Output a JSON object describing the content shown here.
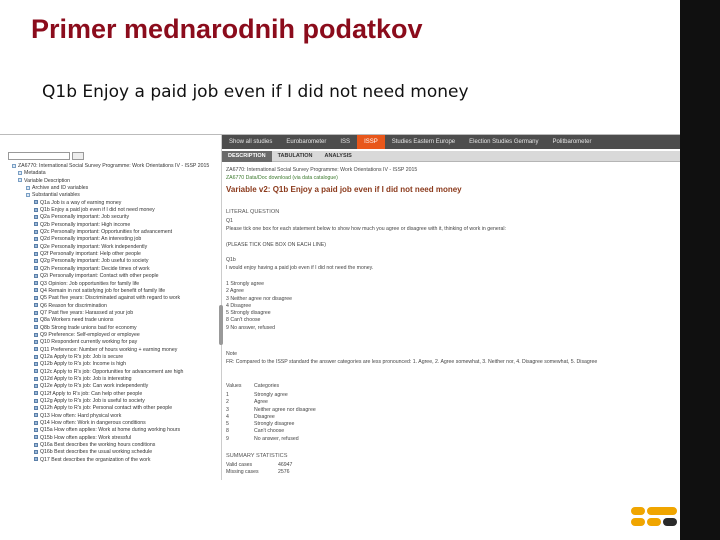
{
  "slide": {
    "title": "Primer mednarodnih podatkov",
    "subtitle": "Q1b Enjoy a paid job even if I did not need money"
  },
  "colors": {
    "title": "#8b0c1c",
    "nav_bg": "#4d4d4d",
    "nav_active": "#e8571b",
    "sidebar": "#101010"
  },
  "screenshot": {
    "nav": [
      "Show all studies",
      "Eurobarometer",
      "ISS",
      "ISSP",
      "Studies Eastern Europe",
      "Election Studies Germany",
      "Politbarometer"
    ],
    "nav_active_index": 3,
    "subtabs": [
      "DESCRIPTION",
      "TABULATION",
      "ANALYSIS"
    ],
    "subtab_active_index": 0,
    "tree": [
      "ZA6770: International Social Survey Programme: Work Orientations IV - ISSP 2015",
      "Metadata",
      "Variable Description",
      "Archive and ID variables",
      "Substantial variables",
      "Q1a Job is a way of earning money",
      "Q1b Enjoy a paid job even if I did not need money",
      "Q2a Personally important: Job security",
      "Q2b Personally important: High income",
      "Q2c Personally important: Opportunities for advancement",
      "Q2d Personally important: An interesting job",
      "Q2e Personally important: Work independently",
      "Q2f Personally important: Help other people",
      "Q2g Personally important: Job useful to society",
      "Q2h Personally important: Decide times of work",
      "Q2i Personally important: Contact with other people",
      "Q3 Opinion: Job opportunities for family life",
      "Q4 Remain in not satisfying job for benefit of family life",
      "Q5 Past five years: Discriminated against with regard to work",
      "Q6 Reason for discrimination",
      "Q7 Past five years: Harassed at your job",
      "Q8a Workers need trade unions",
      "Q8b Strong trade unions bad for economy",
      "Q9 Preference: Self-employed or employee",
      "Q10 Respondent currently working for pay",
      "Q11 Preference: Number of hours working + earning money",
      "Q12a Apply to R's job: Job is secure",
      "Q12b Apply to R's job: Income is high",
      "Q12c Apply to R's job: Opportunities for advancement are high",
      "Q12d Apply to R's job: Job is interesting",
      "Q12e Apply to R's job: Can work independently",
      "Q12f Apply to R's job: Can help other people",
      "Q12g Apply to R's job: Job is useful to society",
      "Q12h Apply to R's job: Personal contact with other people",
      "Q13 How often: Hard physical work",
      "Q14 How often: Work in dangerous conditions",
      "Q15a How often applies: Work at home during working hours",
      "Q15b How often applies: Work stressful",
      "Q16a Best describes the working hours conditions",
      "Q16b Best describes the usual working schedule",
      "Q17 Best describes the organization of the work"
    ],
    "detail": {
      "study": "ZA6770: International Social Survey Programme: Work Orientations IV - ISSP 2015",
      "download": "ZA6770 Data/Doc download (via data catalogue)",
      "variable_title": "Variable v2: Q1b Enjoy a paid job even if I did not need money",
      "literal_label": "LITERAL QUESTION",
      "literal_q": "Q1",
      "literal_text": "Please tick one box for each statement below to show how much you agree or disagree with it, thinking of work in general:",
      "instruction": "(PLEASE TICK ONE BOX ON EACH LINE)",
      "item_code": "Q1b",
      "item_text": "I would enjoy having a paid job even if I did not need the money.",
      "options": [
        "1 Strongly agree",
        "2 Agree",
        "3 Neither agree nor disagree",
        "4 Disagree",
        "5 Strongly disagree",
        "8 Can't choose",
        "9 No answer, refused"
      ],
      "note_label": "Note",
      "note_text": "FR: Compared to the ISSP standard the answer categories are less pronounced: 1. Agree, 2. Agree somewhat, 3. Neither nor, 4. Disagree somewhat, 5. Disagree",
      "categories_header": {
        "values": "Values",
        "categories": "Categories"
      },
      "categories": [
        {
          "value": "1",
          "label": "Strongly agree"
        },
        {
          "value": "2",
          "label": "Agree"
        },
        {
          "value": "3",
          "label": "Neither agree nor disagree"
        },
        {
          "value": "4",
          "label": "Disagree"
        },
        {
          "value": "5",
          "label": "Strongly disagree"
        },
        {
          "value": "8",
          "label": "Can't choose"
        },
        {
          "value": "9",
          "label": "No answer, refused"
        }
      ],
      "summary_label": "SUMMARY STATISTICS",
      "stats": [
        {
          "label": "Valid cases",
          "value": "46947"
        },
        {
          "label": "Missing cases",
          "value": "2576"
        }
      ]
    }
  }
}
